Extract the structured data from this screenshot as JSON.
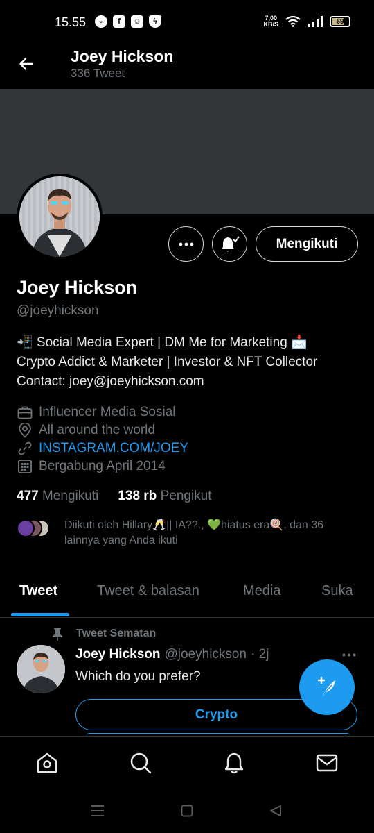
{
  "status_bar": {
    "time": "15.55",
    "speed_value": "7,00",
    "speed_unit": "KB/S",
    "battery": "69",
    "notification_icons": [
      "messenger-icon",
      "facebook-icon",
      "app-icon",
      "shield-icon"
    ]
  },
  "header": {
    "name": "Joey Hickson",
    "tweet_count": "336 Tweet"
  },
  "profile": {
    "follow_label": "Mengikuti",
    "name": "Joey Hickson",
    "handle": "@joeyhickson",
    "bio": [
      "📲 Social Media Expert | DM Me for Marketing 📩",
      "Crypto Addict & Marketer | Investor & NFT Collector",
      "Contact: joey@joeyhickson.com"
    ],
    "meta": {
      "category": "Influencer Media Sosial",
      "location": "All around the world",
      "link": "INSTAGRAM.COM/JOEY",
      "joined": "Bergabung April 2014"
    },
    "following_count": "477",
    "following_label": "Mengikuti",
    "followers_count": "138 rb",
    "followers_label": "Pengikut",
    "followed_by": "Diikuti oleh Hillary🥂|| IA??., 💚hiatus era🍭, dan 36 lainnya yang Anda ikuti"
  },
  "tabs": [
    "Tweet",
    "Tweet & balasan",
    "Media",
    "Suka"
  ],
  "pinned_tweet": {
    "pinned_label": "Tweet Sematan",
    "name": "Joey Hickson",
    "handle": "@joeyhickson",
    "time": "· 2j",
    "text": "Which do you prefer?",
    "poll_options": [
      "Crypto"
    ]
  },
  "colors": {
    "accent": "#1d9bf0",
    "background": "#000000",
    "banner": "#333639",
    "secondary_text": "#71767b"
  }
}
